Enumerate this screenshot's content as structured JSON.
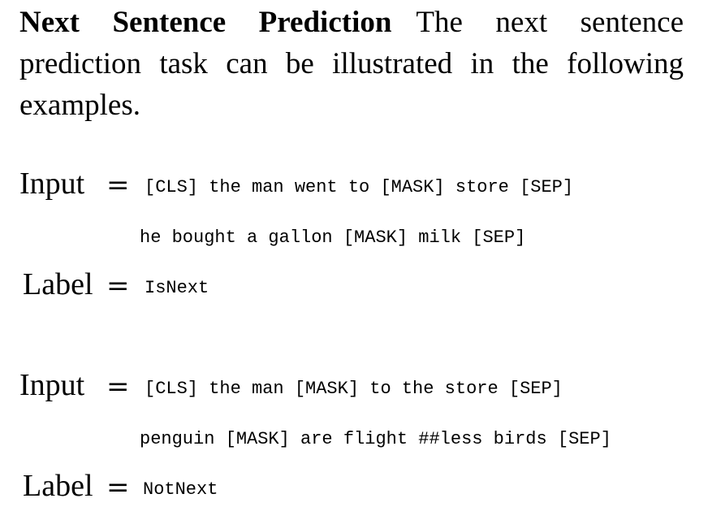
{
  "paragraph": {
    "heading": "Next Sentence Prediction",
    "text": "The next sentence prediction task can be illustrated in the following examples."
  },
  "equals_sign": "=",
  "examples": [
    {
      "input_label": "Input",
      "input_line1": "[CLS] the man went to [MASK] store [SEP]",
      "input_line2": "he bought a gallon [MASK] milk [SEP]",
      "label_label": "Label",
      "label_value": "IsNext"
    },
    {
      "input_label": "Input",
      "input_line1": "[CLS] the man [MASK] to the store [SEP]",
      "input_line2": "penguin [MASK] are flight ##less birds [SEP]",
      "label_label": "Label",
      "label_value": "NotNext"
    }
  ]
}
